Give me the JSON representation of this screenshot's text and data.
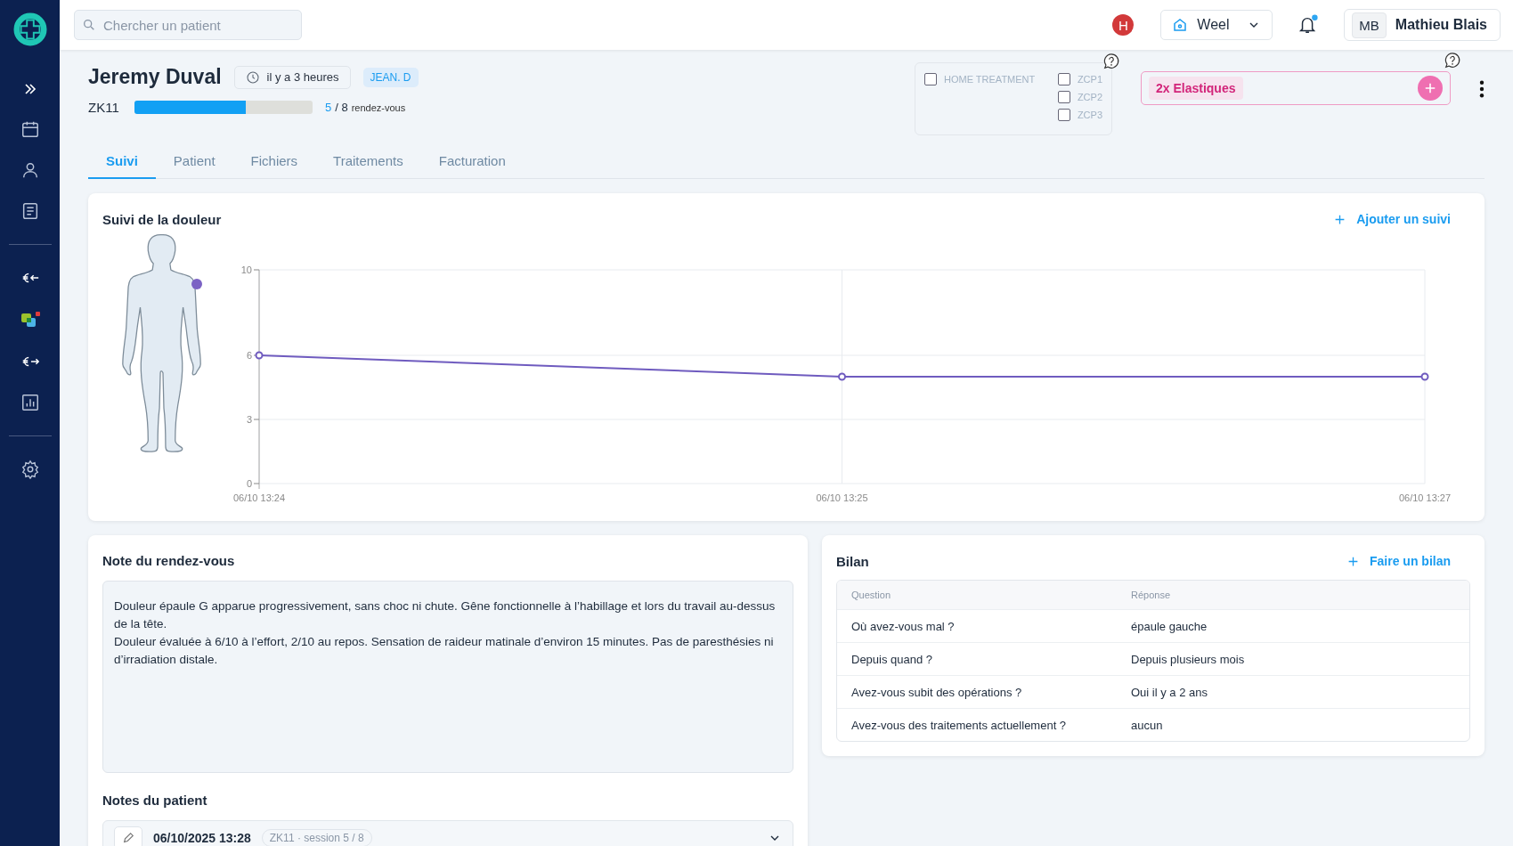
{
  "search": {
    "placeholder": "Chercher un patient"
  },
  "header": {
    "hospital_badge": "H",
    "workspace": "Weel",
    "user": {
      "initials": "MB",
      "name": "Mathieu Blais"
    }
  },
  "patient": {
    "name": "Jeremy Duval",
    "time": "il y a 3 heures",
    "tag": "JEAN. D",
    "program": "ZK11",
    "progress": {
      "level": 0.625,
      "done": "5",
      "total": "/ 8",
      "unit": "rendez-vous"
    }
  },
  "home_treatment": {
    "label": "HOME TREATMENT",
    "checked": false
  },
  "zcp": [
    {
      "label": "ZCP1",
      "checked": false
    },
    {
      "label": "ZCP2",
      "checked": false
    },
    {
      "label": "ZCP3",
      "checked": false
    }
  ],
  "equipment": [
    {
      "label": "2x Elastiques"
    }
  ],
  "tabs": [
    {
      "label": "Suivi",
      "selected": true
    },
    {
      "label": "Patient",
      "selected": false
    },
    {
      "label": "Fichiers",
      "selected": false
    },
    {
      "label": "Traitements",
      "selected": false
    },
    {
      "label": "Facturation",
      "selected": false
    }
  ],
  "pain_tracking": {
    "title": "Suivi de la douleur",
    "action": "Ajouter un suivi",
    "chart_data": {
      "type": "line",
      "categories": [
        "06/10 13:24",
        "06/10 13:25",
        "06/10 13:27"
      ],
      "series": [
        {
          "color": "#6f5bbf",
          "marker": "circle",
          "values": [
            6,
            5,
            5
          ]
        }
      ],
      "grid": true,
      "ylim": [
        0,
        10
      ],
      "yticks": [
        0,
        3,
        6,
        10
      ]
    }
  },
  "appointment_note": {
    "title": "Note du rendez-vous",
    "text": "Douleur épaule G apparue progressivement, sans choc ni chute. Gêne fonctionnelle à l’habillage et lors du travail au-dessus de la tête.\nDouleur évaluée à 6/10 à l’effort, 2/10 au repos. Sensation de raideur matinale d’environ 15 minutes. Pas de paresthésies ni d’irradiation distale."
  },
  "patient_notes": {
    "title": "Notes du patient",
    "items": [
      {
        "date": "06/10/2025 13:28",
        "session": "ZK11 · session 5 / 8",
        "expanded": false
      }
    ]
  },
  "assessment": {
    "title": "Bilan",
    "action": "Faire un bilan",
    "columns": [
      "Question",
      "Réponse"
    ],
    "rows": [
      {
        "question": "Où avez-vous mal ?",
        "answer": "épaule gauche"
      },
      {
        "question": "Depuis quand ?",
        "answer": "Depuis plusieurs mois"
      },
      {
        "question": "Avez-vous subit des opérations ?",
        "answer": "Oui il y a 2 ans"
      },
      {
        "question": "Avez-vous des traitements actuellement ?",
        "answer": "aucun"
      }
    ]
  }
}
